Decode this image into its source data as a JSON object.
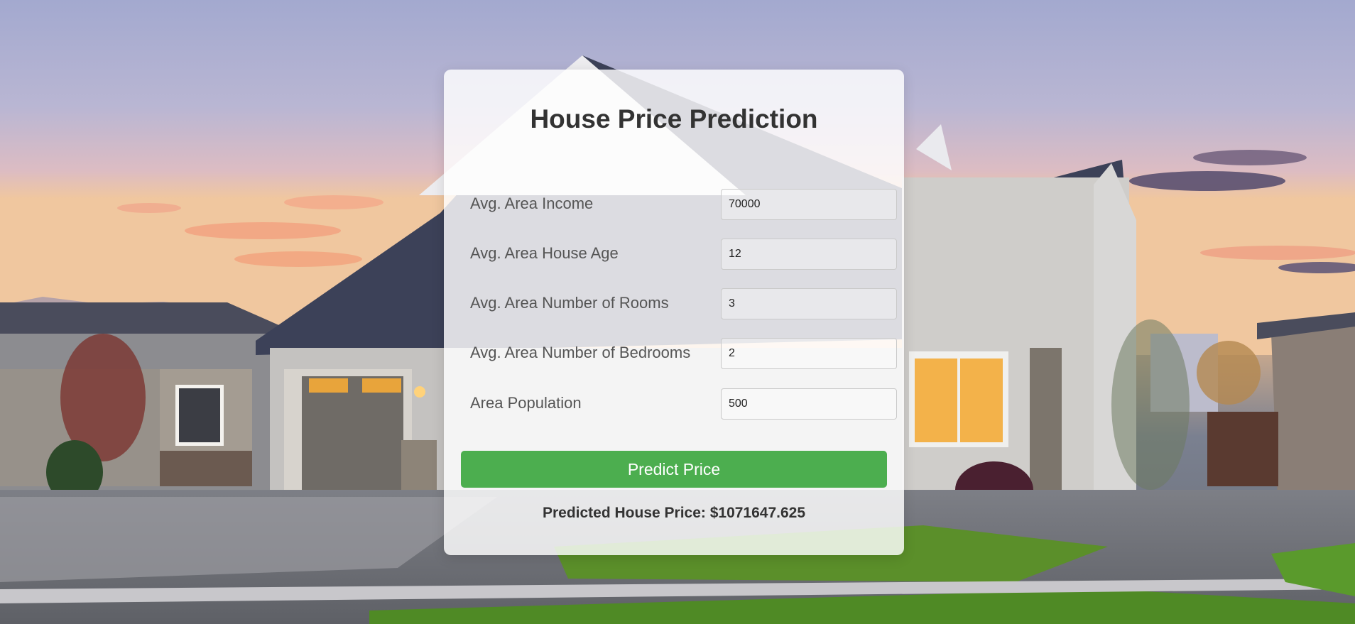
{
  "page": {
    "title": "House Price Prediction",
    "background": "photo of a suburban house at dusk"
  },
  "form": {
    "fields": [
      {
        "label": "Avg. Area Income",
        "value": "70000"
      },
      {
        "label": "Avg. Area House Age",
        "value": "12"
      },
      {
        "label": "Avg. Area Number of Rooms",
        "value": "3"
      },
      {
        "label": "Avg. Area Number of Bedrooms",
        "value": "2"
      },
      {
        "label": "Area Population",
        "value": "500"
      }
    ],
    "submit_label": "Predict Price"
  },
  "result": {
    "text": "Predicted House Price: $1071647.625"
  },
  "colors": {
    "button": "#4cae4f",
    "title_text": "#333333",
    "label_text": "#555555"
  }
}
